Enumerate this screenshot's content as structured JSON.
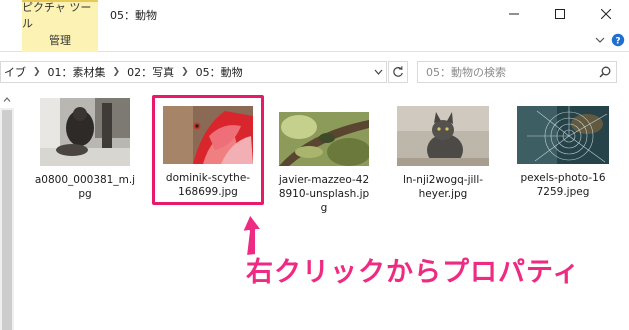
{
  "titlebar": {
    "tool_tab": "ピクチャ ツール",
    "title": "05：動物",
    "minimize": "minimize-icon",
    "maximize": "maximize-icon",
    "close": "close-icon"
  },
  "ribbon": {
    "manage_tab": "管理"
  },
  "address": {
    "crumbs": [
      "イブ",
      "01：素材集",
      "02：写真",
      "05：動物"
    ],
    "refresh": "refresh-icon"
  },
  "search": {
    "placeholder": "05：動物の検索"
  },
  "files": [
    {
      "name": "a0800_000381_m.jpg",
      "selected": false
    },
    {
      "name": "dominik-scythe-168699.jpg",
      "selected": true
    },
    {
      "name": "javier-mazzeo-428910-unsplash.jpg",
      "selected": false
    },
    {
      "name": "ln-nji2wogq-jill-heyer.jpg",
      "selected": false
    },
    {
      "name": "pexels-photo-167259.jpeg",
      "selected": false
    }
  ],
  "file_labels": [
    [
      "a0800_000381_m.j",
      "pg"
    ],
    [
      "dominik-scythe-",
      "168699.jpg"
    ],
    [
      "javier-mazzeo-42",
      "8910-unsplash.jp",
      "g"
    ],
    [
      "ln-nji2wogq-jill-",
      "heyer.jpg"
    ],
    [
      "pexels-photo-16",
      "7259.jpeg"
    ]
  ],
  "annotation": {
    "text": "右クリックからプロパティ",
    "color": "#ee2a82"
  },
  "colors": {
    "tool_tab": "#fcf2b4",
    "highlight": "#e8196b"
  }
}
